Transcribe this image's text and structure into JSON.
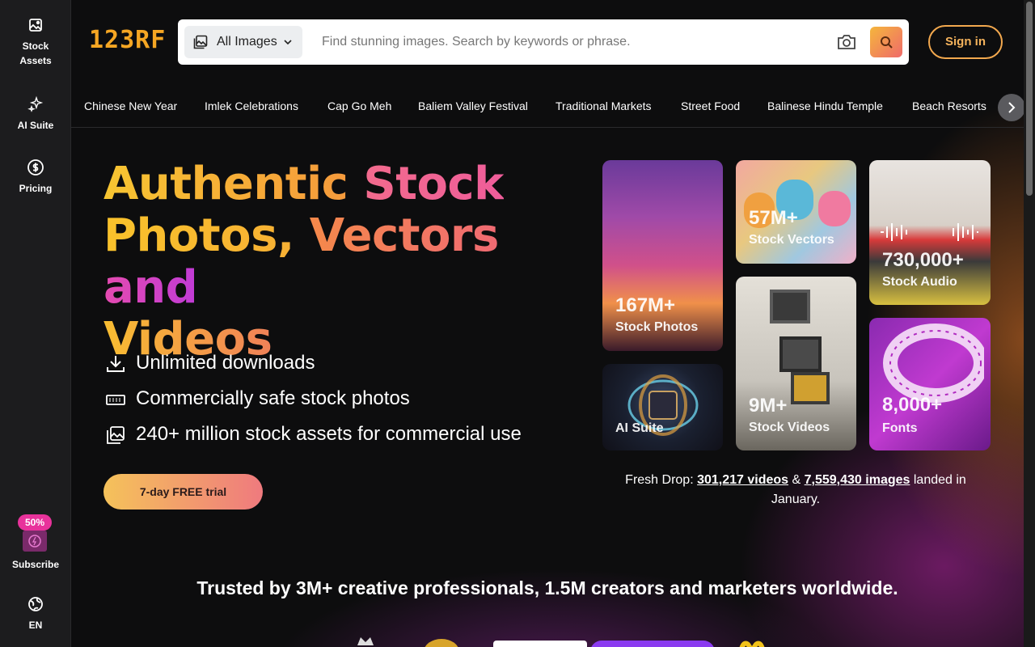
{
  "sidebar": {
    "items": [
      {
        "label": "Stock Assets",
        "icon": "image-stack-icon"
      },
      {
        "label": "AI Suite",
        "icon": "sparkle-icon"
      },
      {
        "label": "Pricing",
        "icon": "dollar-circle-icon"
      }
    ],
    "subscribe": {
      "badge": "50%",
      "label": "Subscribe"
    },
    "language": {
      "label": "EN",
      "icon": "globe-icon"
    }
  },
  "header": {
    "logo": "123RF",
    "search": {
      "category": "All Images",
      "placeholder": "Find stunning images. Search by keywords or phrase."
    },
    "sign_in": "Sign in"
  },
  "chips": [
    "Chinese New Year",
    "Imlek Celebrations",
    "Cap Go Meh",
    "Baliem Valley Festival",
    "Traditional Markets",
    "Street Food",
    "Balinese Hindu Temple",
    "Beach Resorts"
  ],
  "hero": {
    "title_parts": [
      "Authentic",
      "Stock",
      "Photos,",
      "Vectors",
      "and",
      "Videos"
    ],
    "features": [
      {
        "text": "Unlimited downloads",
        "icon": "download-icon"
      },
      {
        "text": "Commercially safe stock photos",
        "icon": "ticket-icon"
      },
      {
        "text": "240+ million stock assets for commercial use",
        "icon": "images-icon"
      }
    ],
    "cta": "7-day FREE trial"
  },
  "cards": [
    {
      "num": "167M+",
      "label": "Stock Photos"
    },
    {
      "num": "",
      "label": "AI Suite"
    },
    {
      "num": "57M+",
      "label": "Stock Vectors"
    },
    {
      "num": "9M+",
      "label": "Stock Videos"
    },
    {
      "num": "730,000+",
      "label": "Stock Audio"
    },
    {
      "num": "8,000+",
      "label": "Fonts"
    }
  ],
  "fresh": {
    "prefix": "Fresh Drop:",
    "videos": "301,217 videos",
    "amp": "&",
    "images": "7,559,430 images",
    "suffix": "landed in January."
  },
  "trusted": "Trusted by 3M+ creative professionals, 1.5M creators and marketers worldwide."
}
